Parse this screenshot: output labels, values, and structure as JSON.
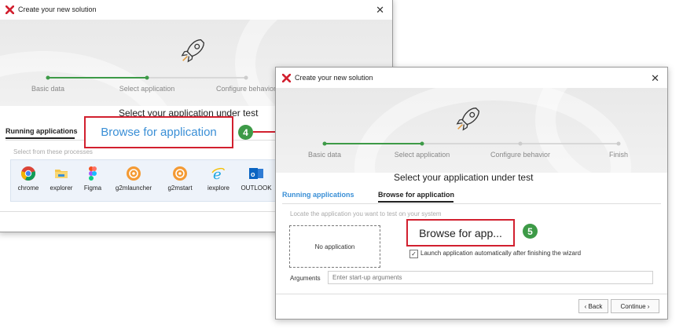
{
  "win1": {
    "title": "Create your new solution",
    "close": "✕",
    "steps": [
      "Basic data",
      "Select application",
      "Configure behavior"
    ],
    "heading": "Select your application under test",
    "tabs": {
      "running": "Running applications"
    },
    "hint": "Select from these processes",
    "processes": [
      "chrome",
      "explorer",
      "Figma",
      "g2mlauncher",
      "g2mstart",
      "iexplore",
      "OUTLOOK"
    ]
  },
  "win2": {
    "title": "Create your new solution",
    "close": "✕",
    "steps": [
      "Basic data",
      "Select application",
      "Configure behavior",
      "Finish"
    ],
    "heading": "Select your application under test",
    "tabs": {
      "running": "Running applications",
      "browse": "Browse for application"
    },
    "hint": "Locate the application you want to test on your system",
    "no_app": "No application",
    "launch_label": "Launch application automatically after finishing the wizard",
    "arguments_label": "Arguments",
    "arguments_placeholder": "Enter start-up arguments",
    "back": "‹ Back",
    "continue": "Continue ›"
  },
  "callouts": {
    "browse_application": "Browse for application",
    "browse_app": "Browse for app...",
    "step4": "4",
    "step5": "5"
  },
  "colors": {
    "accent_green": "#3d9a47",
    "callout_red": "#d2202f",
    "link_blue": "#3a8fd6"
  }
}
